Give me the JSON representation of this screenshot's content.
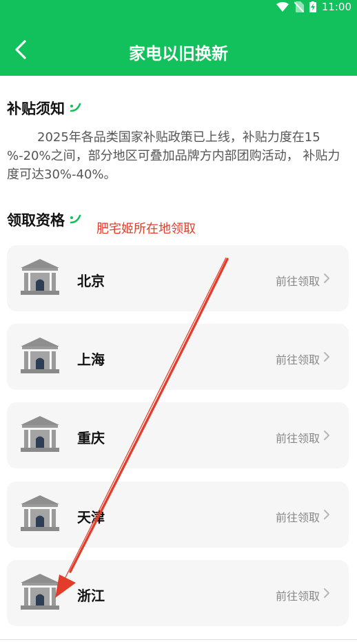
{
  "status_bar": {
    "time": "11:00"
  },
  "header": {
    "title": "家电以旧换新"
  },
  "notice": {
    "title": "补贴须知",
    "body": "2025年各品类国家补贴政策已上线，补贴力度在15 %-20%之间，部分地区可叠加品牌方内部团购活动， 补贴力度可达30%-40%。"
  },
  "eligibility": {
    "title": "领取资格",
    "annotation": "肥宅姬所在地领取"
  },
  "regions": [
    {
      "name": "北京",
      "action": "前往领取"
    },
    {
      "name": "上海",
      "action": "前往领取"
    },
    {
      "name": "重庆",
      "action": "前往领取"
    },
    {
      "name": "天津",
      "action": "前往领取"
    },
    {
      "name": "浙江",
      "action": "前往领取"
    }
  ],
  "colors": {
    "brand": "#12c05c",
    "annotation": "#e23c2a",
    "card_bg": "#f6f6f6"
  },
  "icons": [
    "wifi-icon",
    "no-sim-icon",
    "battery-charging-icon",
    "back-arrow-icon",
    "leaf-icon",
    "government-building-icon",
    "chevron-right-icon"
  ]
}
